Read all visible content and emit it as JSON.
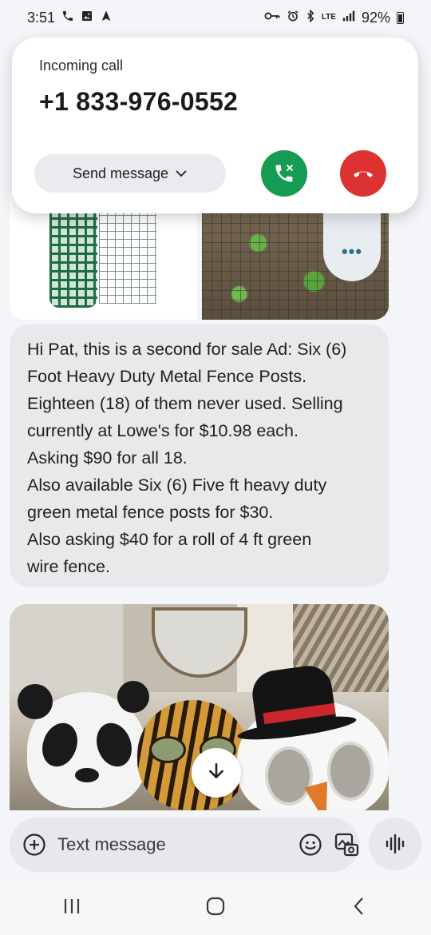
{
  "status_bar": {
    "time": "3:51",
    "network": "LTE",
    "battery": "92%"
  },
  "incoming_call": {
    "label": "Incoming call",
    "number": "+1 833-976-0552",
    "send_message_label": "Send message",
    "answer_icon": "phone-answer-icon",
    "decline_icon": "phone-decline-icon"
  },
  "thread": {
    "more_menu": "•••",
    "message_lines": [
      "Hi Pat, this is a second for sale Ad: Six (6)",
      "Foot Heavy Duty Metal Fence Posts.",
      "Eighteen (18) of them never used. Selling",
      "currently at Lowe's for $10.98 each.",
      "Asking $90 for all 18.",
      "Also available Six (6) Five ft heavy duty",
      "green metal fence posts for $30.",
      "Also asking $40 for a roll of 4 ft green",
      "wire fence."
    ]
  },
  "composer": {
    "placeholder": "Text message"
  },
  "colors": {
    "answer": "#169b53",
    "decline": "#dc3232",
    "bubble": "#e9e9ec",
    "accent": "#2e6f8e"
  }
}
